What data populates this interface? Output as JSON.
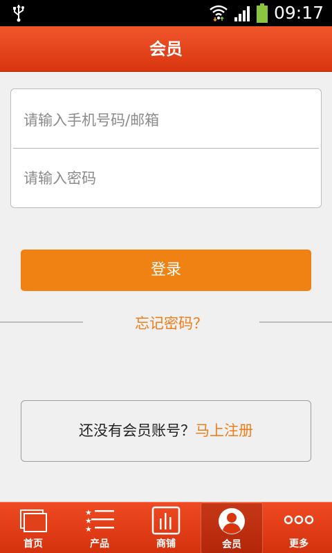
{
  "status_bar": {
    "time": "09:17",
    "icons": [
      "usb-icon",
      "wifi-icon",
      "signal-icon",
      "battery-icon"
    ]
  },
  "header": {
    "title": "会员"
  },
  "login_form": {
    "phone_placeholder": "请输入手机号码/邮箱",
    "password_placeholder": "请输入密码",
    "login_label": "登录",
    "forgot_label": "忘记密码？"
  },
  "register": {
    "prompt": "还没有会员账号？",
    "link": "马上注册"
  },
  "bottom_nav": {
    "items": [
      {
        "label": "首页",
        "icon": "home-icon"
      },
      {
        "label": "产品",
        "icon": "product-list-icon"
      },
      {
        "label": "商铺",
        "icon": "shop-icon"
      },
      {
        "label": "会员",
        "icon": "member-icon",
        "active": true
      },
      {
        "label": "更多",
        "icon": "more-icon"
      }
    ]
  },
  "colors": {
    "header": "#e2461c",
    "accent": "#f08213",
    "link": "#ef7d18",
    "background": "#f0f0f0"
  }
}
